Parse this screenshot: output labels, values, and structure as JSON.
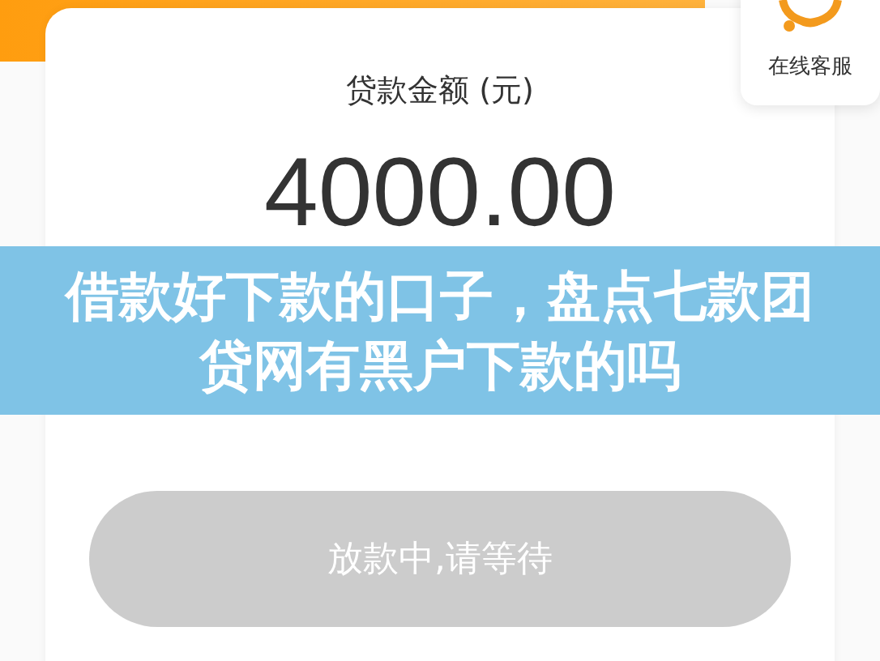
{
  "header": {
    "amount_label": "贷款金额 (元)",
    "amount": "4000.00"
  },
  "service": {
    "label": "在线客服"
  },
  "action_button": {
    "label": "放款中,请等待",
    "disabled": true
  },
  "banner": {
    "title": "借款好下款的口子，盘点七款团贷网有黑户下款的吗"
  }
}
